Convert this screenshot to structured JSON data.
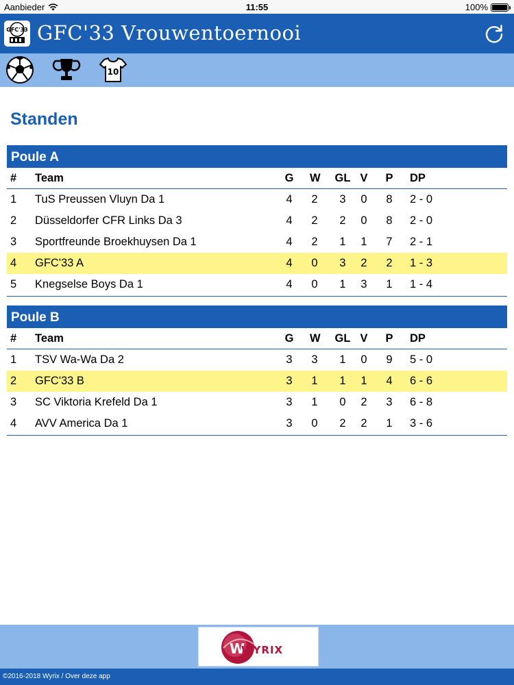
{
  "status_bar": {
    "carrier": "Aanbieder",
    "time": "11:55",
    "battery": "100%"
  },
  "header": {
    "title": "GFC'33 Vrouwentoernooi",
    "logo_text": "GFC'33"
  },
  "toolbar": {
    "icons": [
      "soccer-ball-icon",
      "trophy-icon",
      "jersey-icon"
    ],
    "jersey_number": "10"
  },
  "page": {
    "title": "Standen"
  },
  "columns": {
    "rank": "#",
    "team": "Team",
    "g": "G",
    "w": "W",
    "gl": "GL",
    "v": "V",
    "p": "P",
    "dp": "DP"
  },
  "poule_a": {
    "name": "Poule A",
    "rows": [
      {
        "rank": "1",
        "team": "TuS Preussen Vluyn Da 1",
        "g": "4",
        "w": "2",
        "gl": "3",
        "v": "0",
        "p": "8",
        "dp": "2 - 0"
      },
      {
        "rank": "2",
        "team": "Düsseldorfer CFR Links Da 3",
        "g": "4",
        "w": "2",
        "gl": "2",
        "v": "0",
        "p": "8",
        "dp": "2 - 0"
      },
      {
        "rank": "3",
        "team": "Sportfreunde Broekhuysen Da 1",
        "g": "4",
        "w": "2",
        "gl": "1",
        "v": "1",
        "p": "7",
        "dp": "2 - 1"
      },
      {
        "rank": "4",
        "team": "GFC'33 A",
        "g": "4",
        "w": "0",
        "gl": "3",
        "v": "2",
        "p": "2",
        "dp": "1 - 3",
        "highlight": true
      },
      {
        "rank": "5",
        "team": "Knegselse Boys Da 1",
        "g": "4",
        "w": "0",
        "gl": "1",
        "v": "3",
        "p": "1",
        "dp": "1 - 4"
      }
    ]
  },
  "poule_b": {
    "name": "Poule B",
    "rows": [
      {
        "rank": "1",
        "team": "TSV Wa-Wa Da 2",
        "g": "3",
        "w": "3",
        "gl": "1",
        "v": "0",
        "p": "9",
        "dp": "5 - 0"
      },
      {
        "rank": "2",
        "team": "GFC'33 B",
        "g": "3",
        "w": "1",
        "gl": "1",
        "v": "1",
        "p": "4",
        "dp": "6 - 6",
        "highlight": true
      },
      {
        "rank": "3",
        "team": "SC Viktoria Krefeld Da 1",
        "g": "3",
        "w": "1",
        "gl": "0",
        "v": "2",
        "p": "3",
        "dp": "6 - 8"
      },
      {
        "rank": "4",
        "team": "AVV America Da 1",
        "g": "3",
        "w": "0",
        "gl": "2",
        "v": "2",
        "p": "1",
        "dp": "3 - 6"
      }
    ]
  },
  "footer": {
    "sponsor": "WYRIX",
    "copyright": "©2016-2018 Wyrix / Over deze app"
  },
  "colors": {
    "primary": "#1a5fb4",
    "toolbar": "#8bb6ea",
    "highlight": "#fdf58a",
    "sponsor": "#b3143c"
  }
}
